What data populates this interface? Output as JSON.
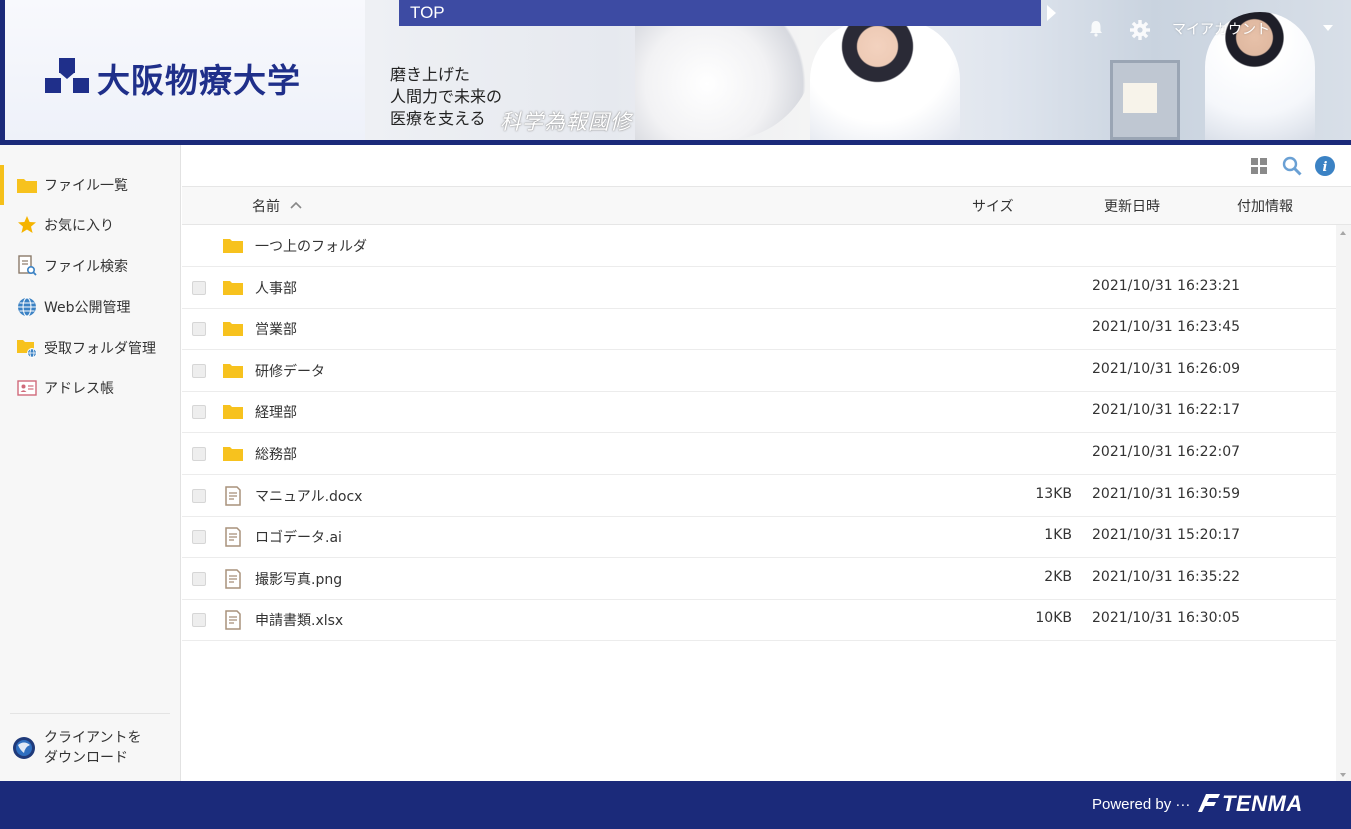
{
  "header": {
    "logo_text": "大阪物療大学",
    "catchphrase": [
      "磨き上げた",
      "人間力で未来の",
      "医療を支える"
    ],
    "motto": "科学為報國修",
    "top_label": "TOP",
    "account_label": "マイアカウント"
  },
  "sidebar": {
    "items": [
      {
        "label": "ファイル一覧",
        "icon": "folder-icon",
        "active": true
      },
      {
        "label": "お気に入り",
        "icon": "star-icon",
        "active": false
      },
      {
        "label": "ファイル検索",
        "icon": "file-search-icon",
        "active": false
      },
      {
        "label": "Web公開管理",
        "icon": "globe-icon",
        "active": false
      },
      {
        "label": "受取フォルダ管理",
        "icon": "folder-globe-icon",
        "active": false
      },
      {
        "label": "アドレス帳",
        "icon": "address-card-icon",
        "active": false
      }
    ],
    "client_download": [
      "クライアントを",
      "ダウンロード"
    ]
  },
  "toolbar": {
    "icons": [
      "grid-view-icon",
      "search-icon",
      "info-icon"
    ]
  },
  "columns": {
    "name": "名前",
    "size": "サイズ",
    "modified": "更新日時",
    "extra": "付加情報"
  },
  "files": [
    {
      "name": "一つ上のフォルダ",
      "type": "folder",
      "size": "",
      "date": "",
      "checkbox": false
    },
    {
      "name": "人事部",
      "type": "folder",
      "size": "",
      "date": "2021/10/31 16:23:21",
      "checkbox": true
    },
    {
      "name": "営業部",
      "type": "folder",
      "size": "",
      "date": "2021/10/31 16:23:45",
      "checkbox": true
    },
    {
      "name": "研修データ",
      "type": "folder",
      "size": "",
      "date": "2021/10/31 16:26:09",
      "checkbox": true
    },
    {
      "name": "経理部",
      "type": "folder",
      "size": "",
      "date": "2021/10/31 16:22:17",
      "checkbox": true
    },
    {
      "name": "総務部",
      "type": "folder",
      "size": "",
      "date": "2021/10/31 16:22:07",
      "checkbox": true
    },
    {
      "name": "マニュアル.docx",
      "type": "file",
      "size": "13KB",
      "date": "2021/10/31 16:30:59",
      "checkbox": true
    },
    {
      "name": "ロゴデータ.ai",
      "type": "file",
      "size": "1KB",
      "date": "2021/10/31 15:20:17",
      "checkbox": true
    },
    {
      "name": "撮影写真.png",
      "type": "file",
      "size": "2KB",
      "date": "2021/10/31 16:35:22",
      "checkbox": true
    },
    {
      "name": "申請書類.xlsx",
      "type": "file",
      "size": "10KB",
      "date": "2021/10/31 16:30:05",
      "checkbox": true
    }
  ],
  "footer": {
    "powered_by": "Powered by",
    "brand": "TENMA"
  },
  "colors": {
    "brand_navy": "#1b2a7a",
    "top_bar": "#3d4ba3",
    "folder_yellow": "#f7c21e",
    "accent_blue": "#3b82c4"
  }
}
